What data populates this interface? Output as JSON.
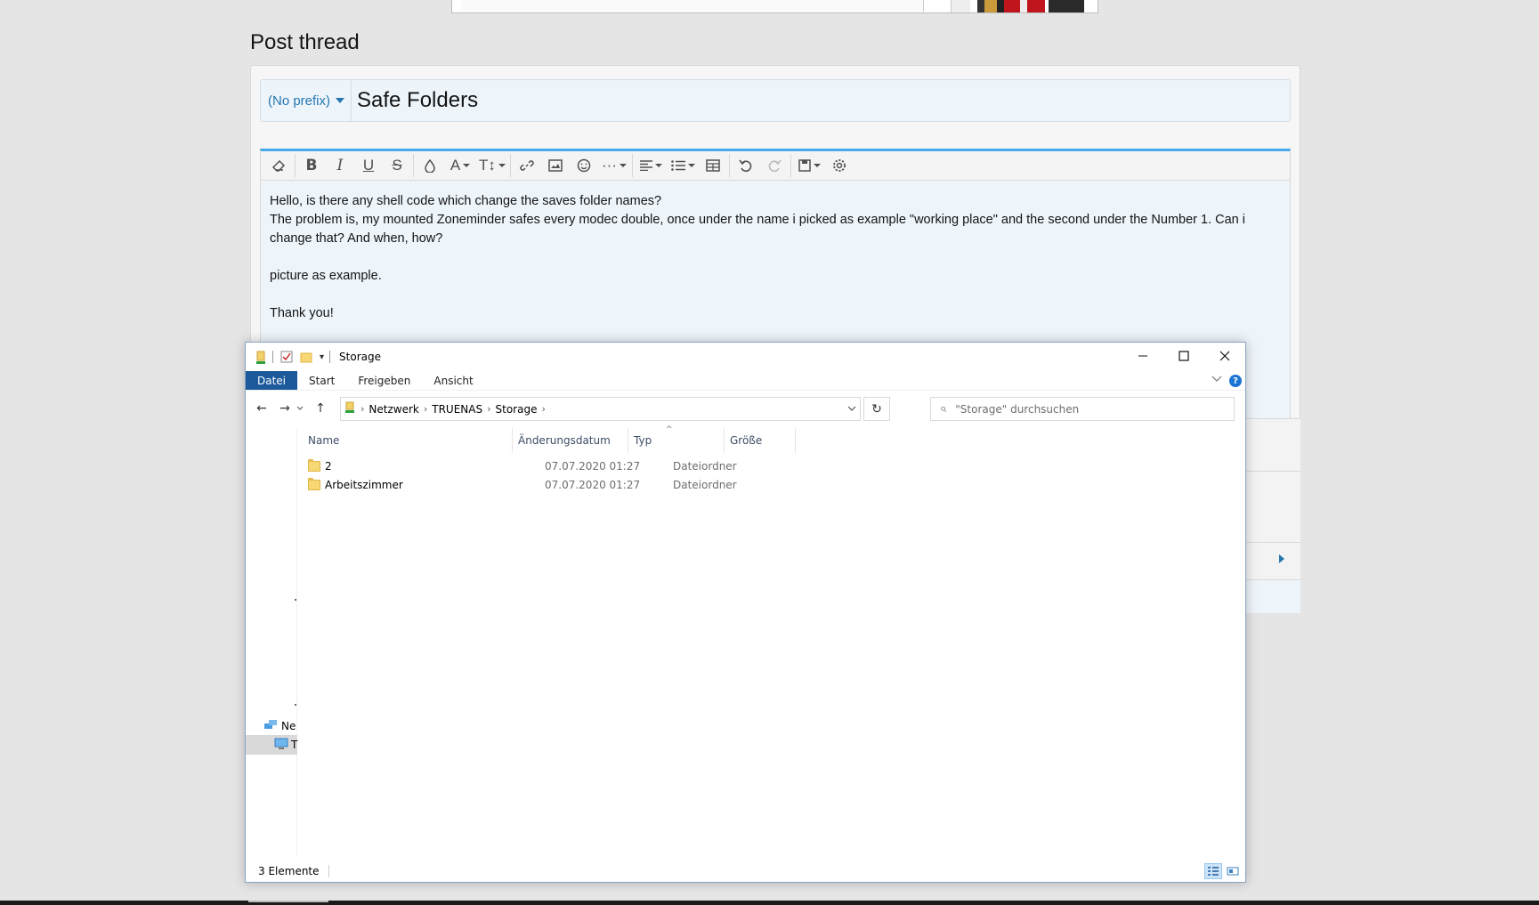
{
  "page": {
    "title": "Post thread",
    "prefix_label": "(No prefix)",
    "thread_title": "Safe Folders",
    "editor_lines": [
      "Hello, is there any shell code which change the saves folder names?",
      "The problem is, my mounted Zoneminder safes every modec double, once under the name i picked as example \"working place\" and the second under the Number 1. Can i change that? And when, how?",
      "",
      "picture as example.",
      "",
      "Thank you!"
    ]
  },
  "toolbar": {
    "buttons": [
      "clear-formatting",
      "bold",
      "italic",
      "underline",
      "strikethrough",
      "text-color",
      "font-family",
      "font-size",
      "insert-link",
      "insert-image",
      "emoji",
      "more-options",
      "align",
      "list",
      "insert-table",
      "undo",
      "redo",
      "drafts",
      "settings"
    ]
  },
  "explorer": {
    "window_title": "Storage",
    "ribbon_tabs": [
      "Datei",
      "Start",
      "Freigeben",
      "Ansicht"
    ],
    "breadcrumb": [
      "Netzwerk",
      "TRUENAS",
      "Storage"
    ],
    "search_placeholder": "\"Storage\" durchsuchen",
    "columns": [
      "Name",
      "Änderungsdatum",
      "Typ",
      "Größe"
    ],
    "files": [
      {
        "name": "2",
        "date": "07.07.2020 01:27",
        "type": "Dateiordner",
        "size": ""
      },
      {
        "name": "Arbeitszimmer",
        "date": "07.07.2020 01:27",
        "type": "Dateiordner",
        "size": ""
      }
    ],
    "navpane_items": [
      "Ne",
      "T"
    ],
    "status_count": "3 Elemente",
    "help_label": "?"
  },
  "colors": {
    "accent": "#2577b1",
    "editor_border": "#47a7eb",
    "ribbon_active": "#1c5a9c"
  }
}
